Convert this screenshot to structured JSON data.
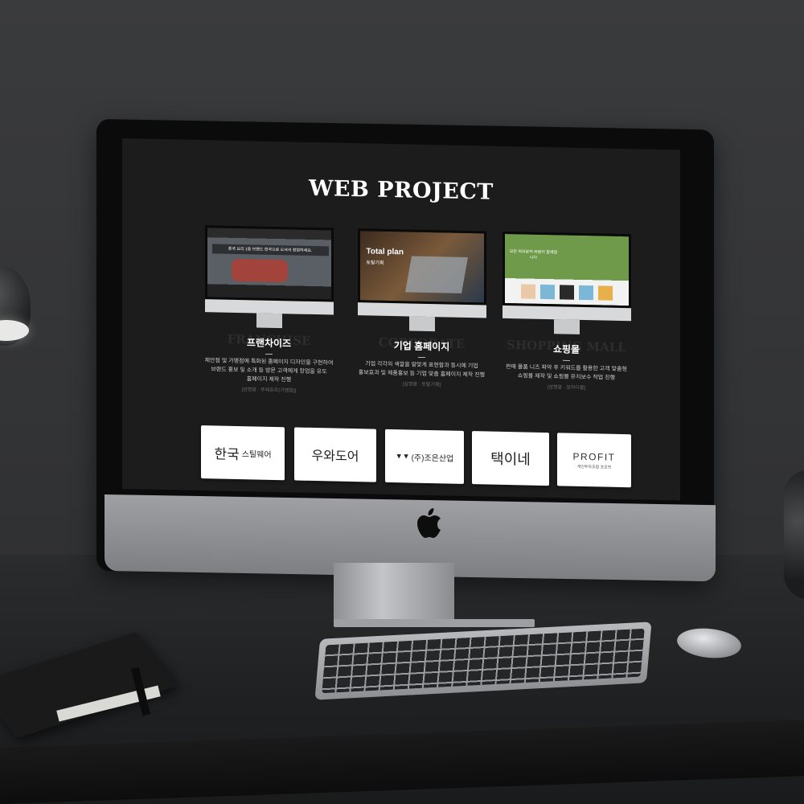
{
  "screen": {
    "title": "WEB PROJECT",
    "projects": [
      {
        "name": "프랜차이즈",
        "ghost": "FRANCHISE",
        "dash": "—",
        "desc_lines": [
          "제안점 및 가맹점에 특화된 홈페이지 디자인을 구현하여",
          "브랜드 홍보 및 소개 등 방문 고객에게 창업을 유도",
          "홈페이지 제작 진행"
        ],
        "tag": "[삼영왕 · 뚜레쥬르(가맹점)]"
      },
      {
        "name": "기업 홈페이지",
        "ghost": "CORPORATE",
        "dash": "—",
        "desc_lines": [
          "기업 각각의 색깔을 알맞게 표현함과 동시에 기업",
          "홍보효과 및 제품홍보 등 기업 맞춤 홈페이지 제작 진행"
        ],
        "tag": "[삼영왕 · 토탈기획]"
      },
      {
        "name": "쇼핑몰",
        "ghost": "SHOPPING MALL",
        "dash": "—",
        "desc_lines": [
          "판매 물품 니즈 파악 후 키워드를 활용한 고객 맞춤형",
          "쇼핑몰 제작 및 쇼핑몰 유지보수 작업 진행"
        ],
        "tag": "[삼영왕 · 모아다몰]"
      }
    ],
    "logos": [
      {
        "main": "한국",
        "sub": "스틸웨어"
      },
      {
        "main": "우와도어",
        "sub": ""
      },
      {
        "main": "(주)조은산업",
        "sub": ""
      },
      {
        "main": "택이네",
        "sub": ""
      },
      {
        "main": "PROFIT",
        "sub": "개인투자조합 프로핏"
      }
    ],
    "mini_screens": {
      "franchise_headline": "중국 요리 1등 브랜드 한국으로 오셔서 창업하세요.",
      "corporate_headline": "Total plan",
      "corporate_sub": "토탈기획",
      "shop_headline": "모든 여러분의 바람이 함께합니다"
    }
  },
  "colors": {
    "background": "#353638",
    "screen_bg": "#1c1c1d",
    "title_text": "#ffffff",
    "logo_card": "#ffffff"
  },
  "icons": [
    "apple-logo-icon",
    "desk-lamp",
    "keyboard",
    "mouse",
    "notebook",
    "speaker"
  ]
}
